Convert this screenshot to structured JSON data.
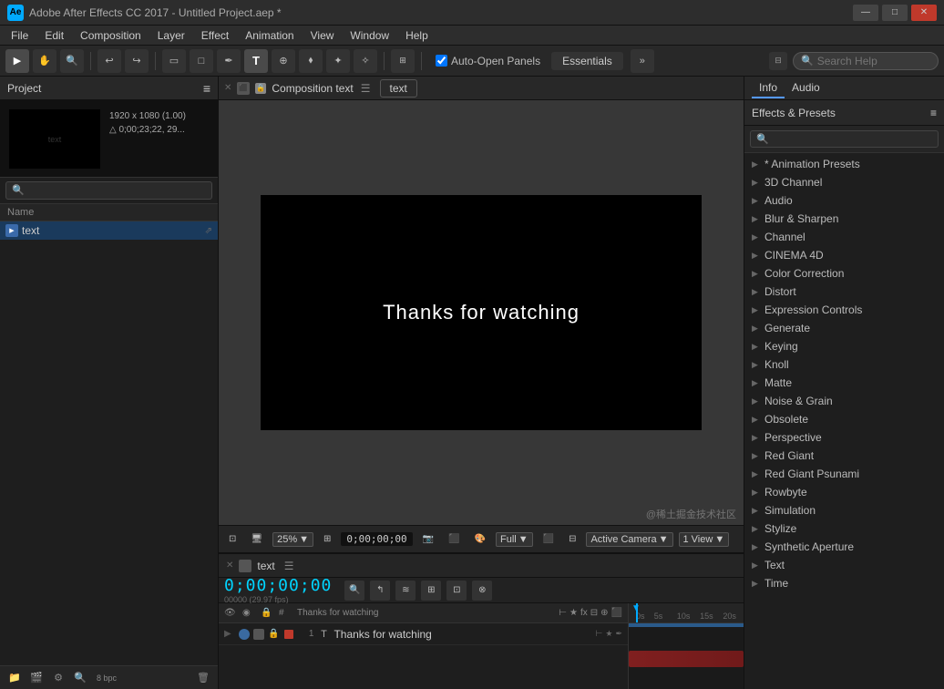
{
  "titleBar": {
    "appIcon": "Ae",
    "title": "Adobe After Effects CC 2017 - Untitled Project.aep *",
    "winControls": [
      "—",
      "□",
      "✕"
    ]
  },
  "menuBar": {
    "items": [
      "File",
      "Edit",
      "Composition",
      "Layer",
      "Effect",
      "Animation",
      "View",
      "Window",
      "Help"
    ]
  },
  "toolbar": {
    "autoOpenLabel": "Auto-Open Panels",
    "essentials": "Essentials",
    "searchPlaceholder": "Search Help"
  },
  "projectPanel": {
    "title": "Project",
    "previewInfo": {
      "line1": "1920 x 1080 (1.00)",
      "line2": "△ 0;00;23;22, 29..."
    },
    "searchPlaceholder": "🔍",
    "columnHeader": "Name",
    "items": [
      {
        "name": "text",
        "type": "comp"
      }
    ]
  },
  "compViewer": {
    "tabClose": "✕",
    "tabLabel": "Composition text",
    "tabMenu": "☰",
    "tabPill": "text",
    "canvasText": "Thanks for watching",
    "bottomBar": {
      "zoom": "25%",
      "timecode": "0;00;00;00",
      "viewMode": "Full",
      "camera": "Active Camera",
      "viewLabel": "1 View"
    }
  },
  "timelinePanel": {
    "closeLabel": "✕",
    "compName": "text",
    "menuLabel": "☰",
    "timecodeDisplay": "0;00;00;00",
    "fpsInfo": "00000 (29.97 fps)",
    "layers": [
      {
        "number": "1",
        "typeIcon": "T",
        "name": "Thanks for watching",
        "color": "#c0392b"
      }
    ],
    "rulerMarks": [
      "0s",
      "5s",
      "10s",
      "15s",
      "20s"
    ]
  },
  "rightPanel": {
    "tabs": [
      "Info",
      "Audio"
    ],
    "effectsPresetsLabel": "Effects & Presets",
    "effectsMenu": "≡",
    "searchPlaceholder": "",
    "effectsList": [
      {
        "label": "* Animation Presets",
        "hasArrow": true
      },
      {
        "label": "3D Channel",
        "hasArrow": true
      },
      {
        "label": "Audio",
        "hasArrow": true
      },
      {
        "label": "Blur & Sharpen",
        "hasArrow": true
      },
      {
        "label": "Channel",
        "hasArrow": true
      },
      {
        "label": "CINEMA 4D",
        "hasArrow": true
      },
      {
        "label": "Color Correction",
        "hasArrow": true
      },
      {
        "label": "Distort",
        "hasArrow": true
      },
      {
        "label": "Expression Controls",
        "hasArrow": true
      },
      {
        "label": "Generate",
        "hasArrow": true
      },
      {
        "label": "Keying",
        "hasArrow": true
      },
      {
        "label": "Knoll",
        "hasArrow": true
      },
      {
        "label": "Matte",
        "hasArrow": true
      },
      {
        "label": "Noise & Grain",
        "hasArrow": true
      },
      {
        "label": "Obsolete",
        "hasArrow": true
      },
      {
        "label": "Perspective",
        "hasArrow": true
      },
      {
        "label": "Red Giant",
        "hasArrow": true
      },
      {
        "label": "Red Giant Psunami",
        "hasArrow": true
      },
      {
        "label": "Rowbyte",
        "hasArrow": true
      },
      {
        "label": "Simulation",
        "hasArrow": true
      },
      {
        "label": "Stylize",
        "hasArrow": true
      },
      {
        "label": "Synthetic Aperture",
        "hasArrow": true
      },
      {
        "label": "Text",
        "hasArrow": true
      },
      {
        "label": "Time",
        "hasArrow": true
      }
    ]
  },
  "watermark": "@稀土掘金技术社区"
}
